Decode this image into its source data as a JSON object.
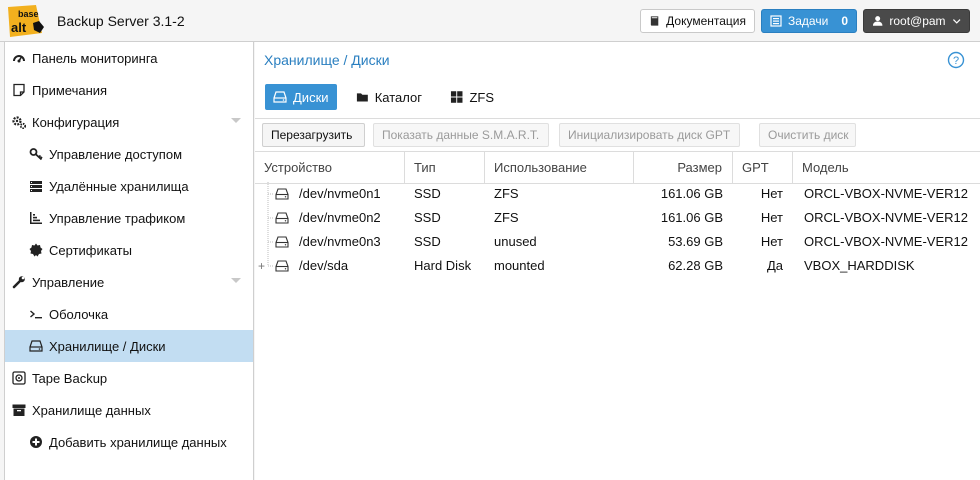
{
  "header": {
    "logo_top": "base",
    "logo_bottom": "alt",
    "app_title": "Backup Server 3.1-2",
    "docs_label": "Документация",
    "tasks_label": "Задачи",
    "tasks_count": "0",
    "user_label": "root@pam"
  },
  "sidebar": {
    "items": [
      {
        "label": "Панель мониторинга",
        "icon": "dashboard-icon"
      },
      {
        "label": "Примечания",
        "icon": "notes-icon"
      },
      {
        "label": "Конфигурация",
        "icon": "cogs-icon"
      },
      {
        "label": "Управление доступом",
        "icon": "key-icon"
      },
      {
        "label": "Удалённые хранилища",
        "icon": "server-icon"
      },
      {
        "label": "Управление трафиком",
        "icon": "traffic-icon"
      },
      {
        "label": "Сертификаты",
        "icon": "certificate-icon"
      },
      {
        "label": "Управление",
        "icon": "wrench-icon"
      },
      {
        "label": "Оболочка",
        "icon": "terminal-icon"
      },
      {
        "label": "Хранилище / Диски",
        "icon": "hdd-icon"
      },
      {
        "label": "Tape Backup",
        "icon": "tape-icon"
      },
      {
        "label": "Хранилище данных",
        "icon": "archive-icon"
      },
      {
        "label": "Добавить хранилище данных",
        "icon": "plus-circle-icon"
      }
    ]
  },
  "main": {
    "title": "Хранилище / Диски",
    "tabs": [
      {
        "label": "Диски",
        "icon": "hdd-icon"
      },
      {
        "label": "Каталог",
        "icon": "folder-icon"
      },
      {
        "label": "ZFS",
        "icon": "zfs-icon"
      }
    ],
    "toolbar": {
      "reload": "Перезагрузить",
      "smart": "Показать данные S.M.A.R.T.",
      "init_gpt": "Инициализировать диск GPT",
      "wipe": "Очистить диск"
    },
    "columns": [
      "Устройство",
      "Тип",
      "Использование",
      "Размер",
      "GPT",
      "Модель"
    ],
    "rows": [
      {
        "device": "/dev/nvme0n1",
        "type": "SSD",
        "usage": "ZFS",
        "size": "161.06 GB",
        "gpt": "Нет",
        "model": "ORCL-VBOX-NVME-VER12",
        "expander": ""
      },
      {
        "device": "/dev/nvme0n2",
        "type": "SSD",
        "usage": "ZFS",
        "size": "161.06 GB",
        "gpt": "Нет",
        "model": "ORCL-VBOX-NVME-VER12",
        "expander": ""
      },
      {
        "device": "/dev/nvme0n3",
        "type": "SSD",
        "usage": "unused",
        "size": "53.69 GB",
        "gpt": "Нет",
        "model": "ORCL-VBOX-NVME-VER12",
        "expander": ""
      },
      {
        "device": "/dev/sda",
        "type": "Hard Disk",
        "usage": "mounted",
        "size": "62.28 GB",
        "gpt": "Да",
        "model": "VBOX_HARDDISK",
        "expander": "+"
      }
    ]
  },
  "colors": {
    "accent": "#3892d4",
    "title_blue": "#2a7fc0",
    "selected_bg": "#c2ddf2",
    "logo_yellow": "#f2b01e"
  }
}
